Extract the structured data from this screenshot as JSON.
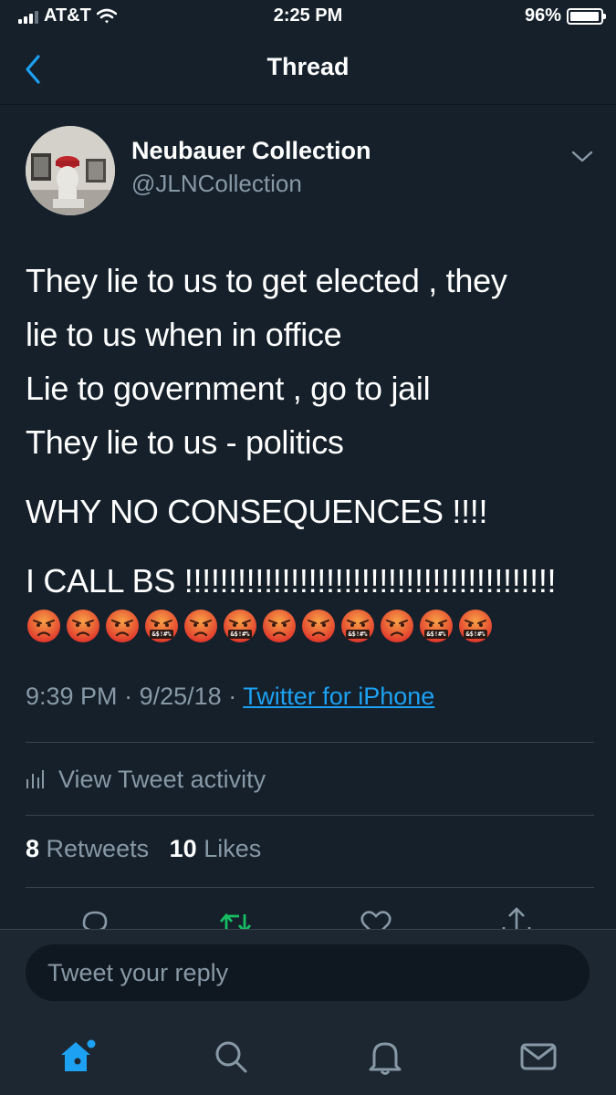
{
  "status_bar": {
    "carrier": "AT&T",
    "time": "2:25 PM",
    "battery": "96%",
    "battery_level": 0.96
  },
  "nav": {
    "title": "Thread"
  },
  "tweet": {
    "author_name": "Neubauer Collection",
    "author_handle": "@JLNCollection",
    "text_lines": [
      "They lie to us to get elected , they",
      "lie to us when in office",
      "Lie to government , go to jail",
      "They lie to us - politics",
      "WHY NO CONSEQUENCES !!!!",
      "I CALL BS !!!!!!!!!!!!!!!!!!!!!!!!!!!!!!!!!!!!!!!!!!"
    ],
    "emojis": [
      "pouting-face",
      "pouting-face",
      "pouting-face",
      "face-with-symbols-on-mouth",
      "pouting-face",
      "face-with-symbols-on-mouth",
      "pouting-face",
      "pouting-face",
      "face-with-symbols-on-mouth",
      "pouting-face",
      "face-with-symbols-on-mouth",
      "face-with-symbols-on-mouth"
    ],
    "emoji_symbol_text": "&$!#%",
    "time": "9:39 PM",
    "date": "9/25/18",
    "separator": "·",
    "source": "Twitter for iPhone"
  },
  "activity": {
    "label": "View Tweet activity"
  },
  "stats": {
    "retweets_count": "8",
    "retweets_label": "Retweets",
    "likes_count": "10",
    "likes_label": "Likes"
  },
  "reply": {
    "placeholder": "Tweet your reply"
  },
  "colors": {
    "background": "#15202b",
    "bar": "#1c2732",
    "accent": "#1da1f2",
    "muted": "#8899a6",
    "retweet": "#17bf63",
    "divider": "#38444d"
  },
  "icons": [
    "back-chevron-icon",
    "caret-down-icon",
    "activity-bars-icon",
    "reply-icon",
    "retweet-icon",
    "like-icon",
    "share-icon",
    "home-icon",
    "search-icon",
    "notifications-icon",
    "messages-icon"
  ]
}
